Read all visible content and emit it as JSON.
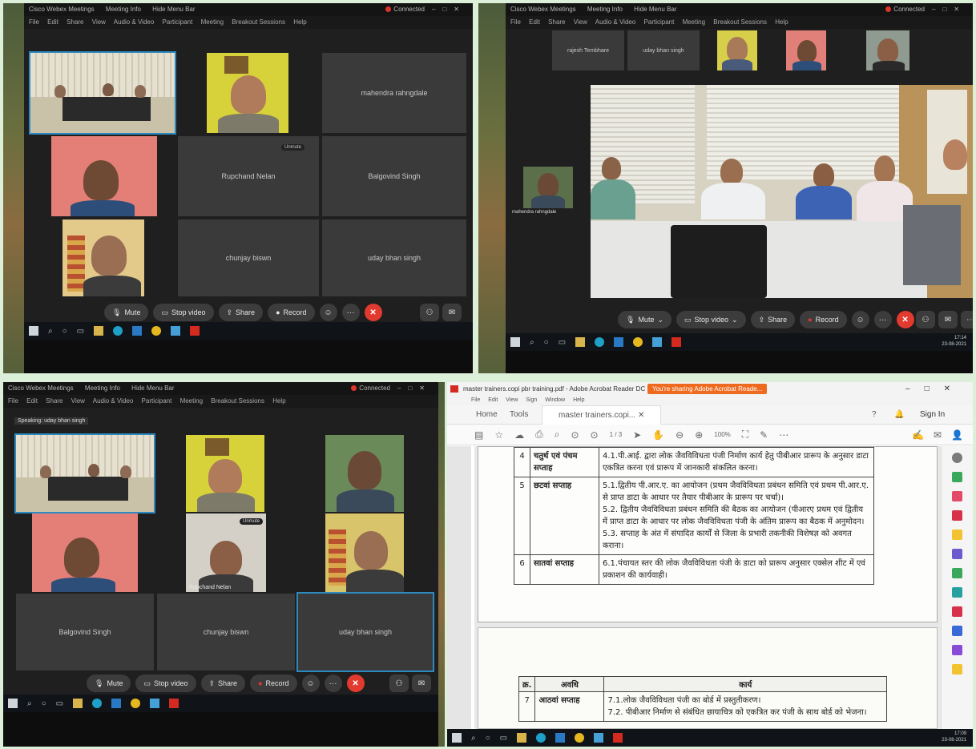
{
  "webex": {
    "title_app": "Cisco Webex Meetings",
    "title_info": "Meeting Info",
    "title_hide": "Hide Menu Bar",
    "connected": "Connected",
    "menu": [
      "File",
      "Edit",
      "Share",
      "View",
      "Audio & Video",
      "Participant",
      "Meeting",
      "Breakout Sessions",
      "Help"
    ],
    "controls": {
      "mute": "Mute",
      "stop_video": "Stop video",
      "share": "Share",
      "record": "Record",
      "more": "···",
      "end": "✕"
    },
    "speaking": "Speaking: uday bhan singh",
    "clock_p2_time": "17:14",
    "clock_p2_date": "23-08-2021"
  },
  "panel1": {
    "tiles": [
      "mahendra rahngdale",
      "Rupchand Nelan",
      "Balgovind Singh",
      "chunjay biswn",
      "uday bhan singh"
    ],
    "mute_tag": "Unmute"
  },
  "panel2": {
    "strip": [
      "rajesh Tembhare",
      "uday bhan singh"
    ],
    "self_caption": "mahendra rahngdale"
  },
  "panel3": {
    "tiles": [
      "Balgovind Singh",
      "chunjay biswn",
      "uday bhan singh"
    ],
    "cam_caption": "Rupchand Nelan"
  },
  "acrobat": {
    "title": "master trainers.copi pbr training.pdf - Adobe Acrobat Reader DC (32-bit)",
    "sharing": "You're sharing Adobe Acrobat Reade...",
    "menu": [
      "File",
      "Edit",
      "View",
      "Sign",
      "Window",
      "Help"
    ],
    "tab_home": "Home",
    "tab_tools": "Tools",
    "tab_doc": "master trainers.copi...",
    "sign_in": "Sign In",
    "page": "1 / 3",
    "zoom": "100%",
    "clock_time": "17:09",
    "clock_date": "23-08-2021",
    "rows": [
      {
        "n": "4",
        "week": "चतुर्थ एवं पंचम सप्ताह",
        "lines": [
          "4.1.पी.आई. द्वारा लोक जैवविविधता पंजी निर्माण कार्य हेतु पीबीआर प्रारूप के अनुसार डाटा एकत्रित करना एवं प्रारूप में जानकारी संकलित करना।"
        ]
      },
      {
        "n": "5",
        "week": "छटवां सप्ताह",
        "lines": [
          "5.1.द्वितीय पी.आर.ए. का आयोजन (प्रथम जैवविविधता प्रबंधन समिति एवं प्रथम पी.आर.ए. से प्राप्त डाटा के आधार पर तैयार पीबीआर के प्रारूप पर चर्चा)।",
          "5.2. द्वितीय जैवविविधता प्रबंधन समिति की बैठक का आयोजन (पीआरए प्रथम एवं द्वितीय में प्राप्त डाटा के आधार पर लोक जैवविविधता पंजी के अंतिम प्रारूप का बैठक में अनुमोदन।",
          "5.3. सप्ताह के अंत में संपादित कार्यों से जिला के प्रभारी तकनीकी विशेषज्ञ को अवगत कराना।"
        ]
      },
      {
        "n": "6",
        "week": "सातवां सप्ताह",
        "lines": [
          "6.1.पंचायत स्तर की लोक जैवविविधता पंजी के डाटा को प्रारूप अनुसार एक्सेल शीट में एवं प्रकाशन की कार्यवाही।"
        ]
      }
    ],
    "table2_head": [
      "क्र.",
      "अवधि",
      "कार्य"
    ],
    "table2_rows": [
      {
        "n": "7",
        "week": "आठवां सप्ताह",
        "lines": [
          "7.1.लोक जैवविविधता पंजी का बोर्ड में प्रस्तुतीकरण।",
          "7.2. पीबीआर निर्माण से संबंधित छायाचित्र को एकत्रित कर पंजी के साथ बोर्ड को भेजना।"
        ]
      }
    ]
  },
  "colors": {
    "accent": "#2d8ac0",
    "end": "#e23a2e",
    "share_banner": "#ee6a1e"
  }
}
